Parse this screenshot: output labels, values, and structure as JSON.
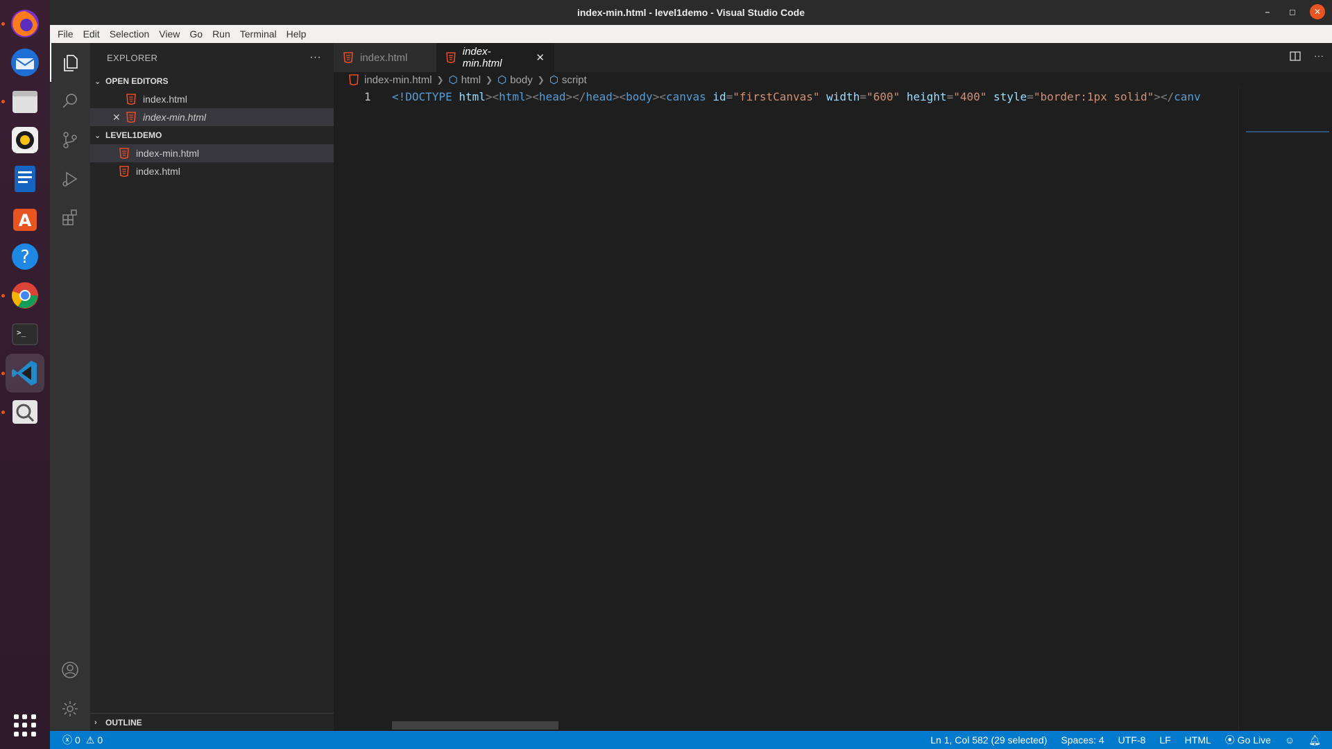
{
  "window": {
    "title": "index-min.html - level1demo - Visual Studio Code"
  },
  "menu": [
    "File",
    "Edit",
    "Selection",
    "View",
    "Go",
    "Run",
    "Terminal",
    "Help"
  ],
  "dock": {
    "apps": [
      "firefox",
      "thunderbird",
      "files",
      "rhythmbox",
      "libreoffice-writer",
      "ubuntu-software",
      "help",
      "chrome",
      "terminal",
      "vscode",
      "screenshot"
    ]
  },
  "sidebar": {
    "title": "EXPLORER",
    "open_editors_label": "OPEN EDITORS",
    "open_editors": [
      "index.html",
      "index-min.html"
    ],
    "folder_label": "LEVEL1DEMO",
    "files": [
      "index-min.html",
      "index.html"
    ],
    "outline_label": "OUTLINE"
  },
  "tabs": [
    "index.html",
    "index-min.html"
  ],
  "breadcrumb": [
    "index-min.html",
    "html",
    "body",
    "script"
  ],
  "editor": {
    "line_number": "1",
    "code_tokens": [
      {
        "t": "<!DOCTYPE ",
        "c": "t-kw"
      },
      {
        "t": "html",
        "c": "t-attr"
      },
      {
        "t": "><",
        "c": "t-pun"
      },
      {
        "t": "html",
        "c": "t-tag"
      },
      {
        "t": "><",
        "c": "t-pun"
      },
      {
        "t": "head",
        "c": "t-tag"
      },
      {
        "t": "></",
        "c": "t-pun"
      },
      {
        "t": "head",
        "c": "t-tag"
      },
      {
        "t": "><",
        "c": "t-pun"
      },
      {
        "t": "body",
        "c": "t-tag"
      },
      {
        "t": "><",
        "c": "t-pun"
      },
      {
        "t": "canvas ",
        "c": "t-tag"
      },
      {
        "t": "id",
        "c": "t-attr"
      },
      {
        "t": "=",
        "c": "t-pun"
      },
      {
        "t": "\"firstCanvas\" ",
        "c": "t-str"
      },
      {
        "t": "width",
        "c": "t-attr"
      },
      {
        "t": "=",
        "c": "t-pun"
      },
      {
        "t": "\"600\" ",
        "c": "t-str"
      },
      {
        "t": "height",
        "c": "t-attr"
      },
      {
        "t": "=",
        "c": "t-pun"
      },
      {
        "t": "\"400\" ",
        "c": "t-str"
      },
      {
        "t": "style",
        "c": "t-attr"
      },
      {
        "t": "=",
        "c": "t-pun"
      },
      {
        "t": "\"border:1px solid\"",
        "c": "t-str"
      },
      {
        "t": "></",
        "c": "t-pun"
      },
      {
        "t": "canv",
        "c": "t-tag"
      }
    ]
  },
  "status": {
    "errors": "0",
    "warnings": "0",
    "cursor": "Ln 1, Col 582 (29 selected)",
    "spaces": "Spaces: 4",
    "encoding": "UTF-8",
    "eol": "LF",
    "language": "HTML",
    "golive": "Go Live"
  },
  "colors": {
    "accent": "#007acc",
    "html_icon": "#e44d26"
  }
}
